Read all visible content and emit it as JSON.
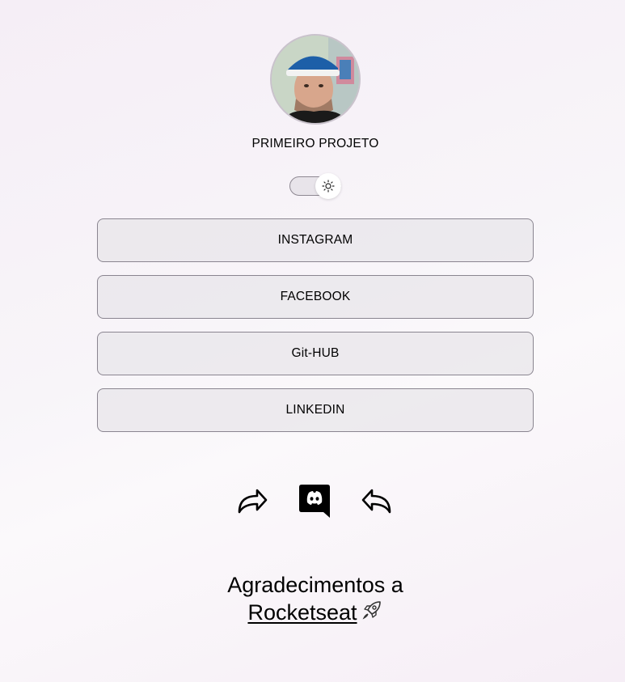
{
  "profile": {
    "avatar_icon": "profile-photo",
    "title": "PRIMEIRO PROJETO"
  },
  "theme_toggle": {
    "icon": "sun-icon",
    "state": "light"
  },
  "links": [
    {
      "label": "INSTAGRAM"
    },
    {
      "label": "FACEBOOK"
    },
    {
      "label": "Git-HUB"
    },
    {
      "label": "LINKEDIN"
    }
  ],
  "social_icons": [
    "share-forward-icon",
    "discord-icon",
    "reply-back-icon"
  ],
  "footer": {
    "line1": "Agradecimentos a",
    "link_text": "Rocketseat",
    "emoji_icon": "rocket-icon"
  }
}
